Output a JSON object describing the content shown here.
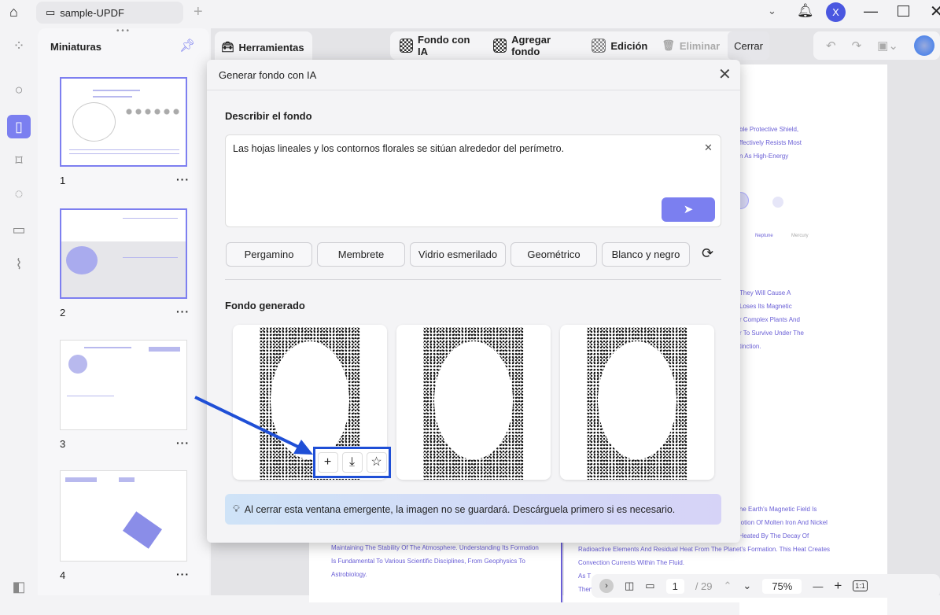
{
  "window": {
    "tab_title": "sample-UPDF",
    "avatar_letter": "X"
  },
  "thumbnails": {
    "title": "Miniaturas",
    "pages": [
      "1",
      "2",
      "3",
      "4"
    ]
  },
  "toolbar": {
    "tools": "Herramientas",
    "ai_background": "Fondo con IA",
    "add_background": "Agregar fondo",
    "edit": "Edición",
    "delete": "Eliminar",
    "close": "Cerrar"
  },
  "dialog": {
    "title": "Generar fondo con IA",
    "describe_label": "Describir el fondo",
    "prompt": "Las hojas lineales y los contornos florales se sitúan alrededor del perímetro.",
    "chips": [
      "Pergamino",
      "Membrete",
      "Vidrio esmerilado",
      "Geométrico",
      "Blanco y negro"
    ],
    "generated_label": "Fondo generado",
    "notice": "Al cerrar esta ventana emergente, la imagen no se guardará. Descárguela primero si es necesario."
  },
  "document": {
    "right_lines": [
      "ble Protective Shield,",
      "ffectively Resists Most",
      "n As High-Energy"
    ],
    "planets": [
      "Neptune",
      "Mercury"
    ],
    "right_lines2": [
      "They Will Cause A",
      "Loses Its Magnetic",
      "r Complex Plants And",
      "r To Survive Under The",
      "tinction."
    ],
    "right_lines3": [
      "The Earth's Magnetic Field Is",
      "Motion Of Molten Iron And Nickel",
      ", Heated By The Decay Of",
      "Radioactive Elements And Residual Heat From The Planet's Formation. This Heat Creates",
      "Convection Currents Within The Fluid.",
      "As T",
      "Then"
    ],
    "left_lines": [
      "Maintaining The Stability Of The Atmosphere. Understanding Its Formation",
      "Is Fundamental To Various Scientific Disciplines, From Geophysics To",
      "Astrobiology."
    ]
  },
  "pagination": {
    "current": "1",
    "total": "/ 29",
    "zoom": "75%"
  },
  "colors": {
    "accent": "#7b7ff0",
    "highlight": "#1f4fd6"
  }
}
